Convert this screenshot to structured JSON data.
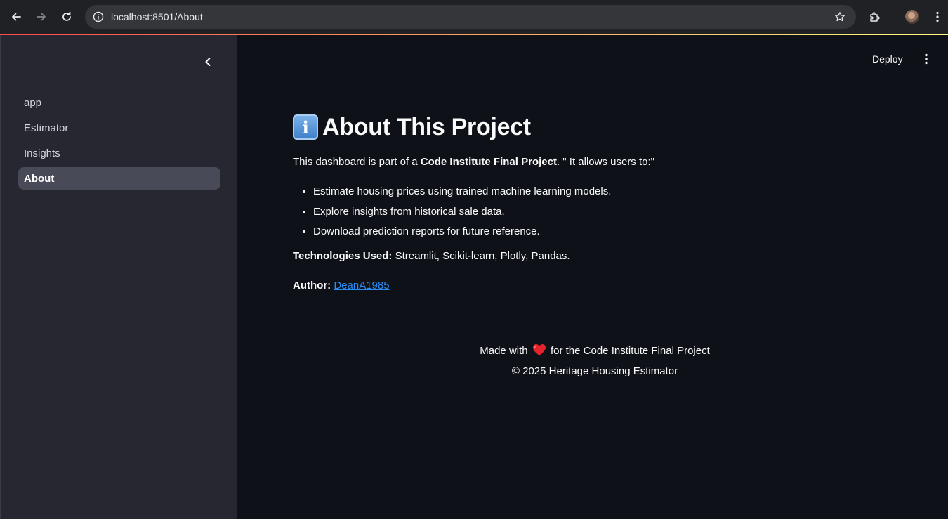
{
  "browser": {
    "url": "localhost:8501/About"
  },
  "sidebar": {
    "items": [
      {
        "label": "app",
        "active": false
      },
      {
        "label": "Estimator",
        "active": false
      },
      {
        "label": "Insights",
        "active": false
      },
      {
        "label": "About",
        "active": true
      }
    ]
  },
  "header": {
    "deploy_label": "Deploy"
  },
  "main": {
    "title_icon": "information-emoji-icon",
    "title": "About This Project",
    "intro_prefix": "This dashboard is part of a ",
    "intro_bold": "Code Institute Final Project",
    "intro_suffix": ". \" It allows users to:\"",
    "bullets": [
      "Estimate housing prices using trained machine learning models.",
      "Explore insights from historical sale data.",
      "Download prediction reports for future reference."
    ],
    "tech_label": "Technologies Used:",
    "tech_value": " Streamlit, Scikit-learn, Plotly, Pandas.",
    "author_label": "Author:",
    "author_link": "DeanA1985"
  },
  "footer": {
    "line1_prefix": "Made with",
    "line1_suffix": "for the Code Institute Final Project",
    "line2": "© 2025 Heritage Housing Estimator"
  },
  "colors": {
    "app_background": "#0e1117",
    "sidebar_background": "#262730",
    "link": "#2a8bf2",
    "active_nav": "#484a57"
  }
}
